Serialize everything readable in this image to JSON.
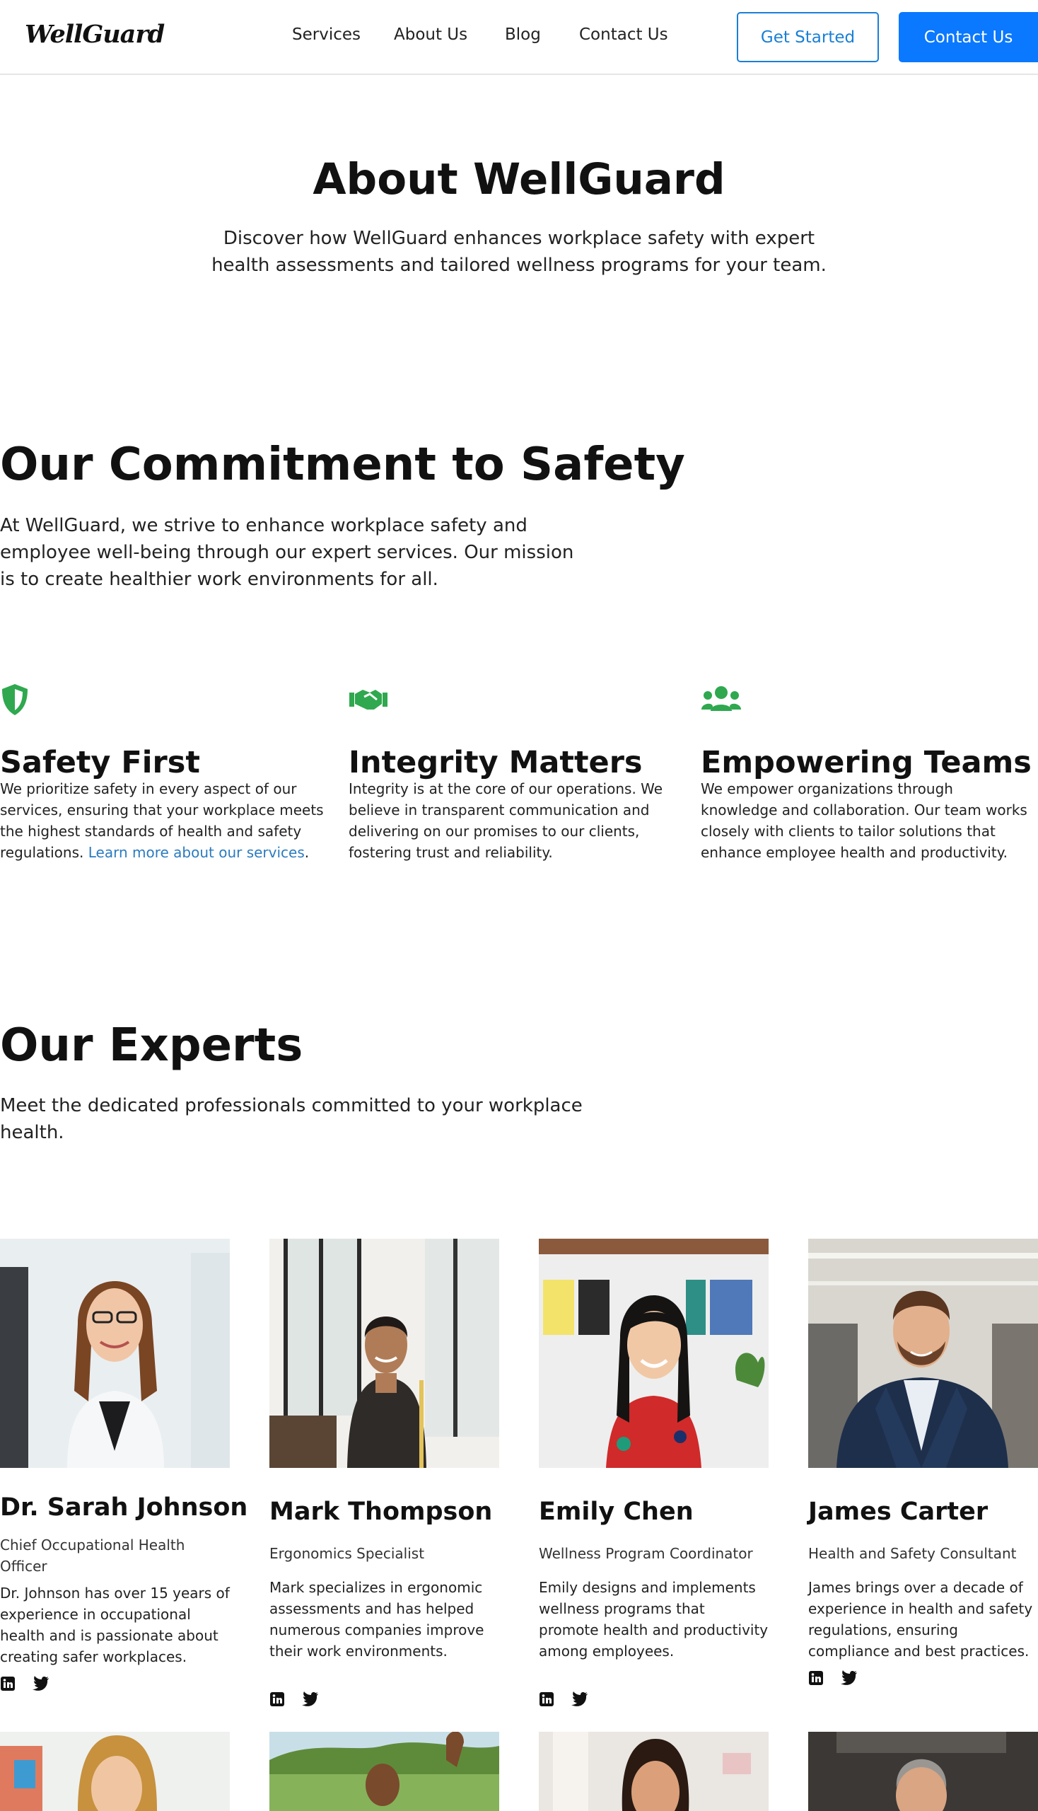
{
  "header": {
    "logo": "WellGuard",
    "nav": [
      "Services",
      "About Us",
      "Blog",
      "Contact Us"
    ],
    "get_started": "Get Started",
    "contact": "Contact Us"
  },
  "hero": {
    "title": "About WellGuard",
    "subtitle": "Discover how WellGuard enhances workplace safety with expert health assessments and tailored wellness programs for your team."
  },
  "commitment": {
    "title": "Our Commitment to Safety",
    "text": "At WellGuard, we strive to enhance workplace safety and employee well-being through our expert services. Our mission is to create healthier work environments for all.",
    "features": [
      {
        "icon": "shield-icon",
        "title": "Safety First",
        "text": "We prioritize safety in every aspect of our services, ensuring that your workplace meets the highest standards of health and safety regulations. ",
        "link": "Learn more about our services",
        "link_suffix": "."
      },
      {
        "icon": "handshake-icon",
        "title": "Integrity Matters",
        "text": "Integrity is at the core of our operations. We believe in transparent communication and delivering on our promises to our clients, fostering trust and reliability."
      },
      {
        "icon": "users-icon",
        "title": "Empowering Teams",
        "text": "We empower organizations through knowledge and collaboration. Our team works closely with clients to tailor solutions that enhance employee health and productivity."
      }
    ]
  },
  "experts": {
    "title": "Our Experts",
    "subtitle": "Meet the dedicated professionals committed to your workplace health.",
    "members": [
      {
        "name": "Dr. Sarah Johnson",
        "role": "Chief Occupational Health Officer",
        "bio": "Dr. Johnson has over 15 years of experience in occupational health and is passionate about creating safer workplaces."
      },
      {
        "name": "Mark Thompson",
        "role": "Ergonomics Specialist",
        "bio": "Mark specializes in ergonomic assessments and has helped numerous companies improve their work environments."
      },
      {
        "name": "Emily Chen",
        "role": "Wellness Program Coordinator",
        "bio": "Emily designs and implements wellness programs that promote health and productivity among employees."
      },
      {
        "name": "James Carter",
        "role": "Health and Safety Consultant",
        "bio": "James brings over a decade of experience in health and safety regulations, ensuring compliance and best practices."
      }
    ]
  },
  "colors": {
    "accent_blue": "#0a78ff",
    "link_blue": "#2b7bbf",
    "icon_green": "#2fa84f"
  }
}
